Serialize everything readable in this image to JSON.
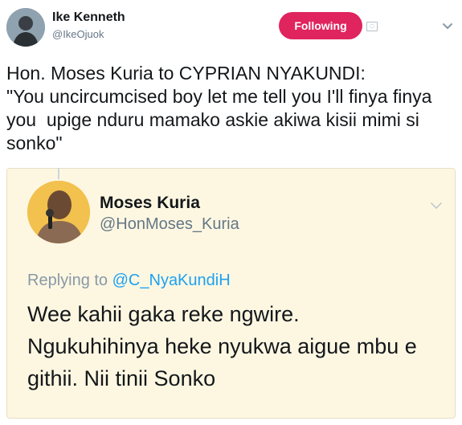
{
  "tweet": {
    "author": {
      "display_name": "Ike Kenneth",
      "handle": "@IkeOjuok"
    },
    "follow_button_label": "Following",
    "text": "Hon. Moses Kuria to CYPRIAN NYAKUNDI:\n\"You uncircumcised boy let me tell you I'll finya finya you  upige nduru mamako askie akiwa kisii mimi si sonko\""
  },
  "quoted_tweet": {
    "author": {
      "display_name": "Moses Kuria",
      "handle": "@HonMoses_Kuria"
    },
    "replying_to_prefix": "Replying to ",
    "replying_to_handle": "@C_NyaKundiH",
    "text": "Wee kahii gaka reke ngwire.\nNgukuhihinya heke nyukwa aigue mbu e githii. Nii tinii Sonko"
  },
  "colors": {
    "follow_button": "#e0245e",
    "quote_background": "#fdf7e2",
    "mention": "#1da1f2"
  }
}
